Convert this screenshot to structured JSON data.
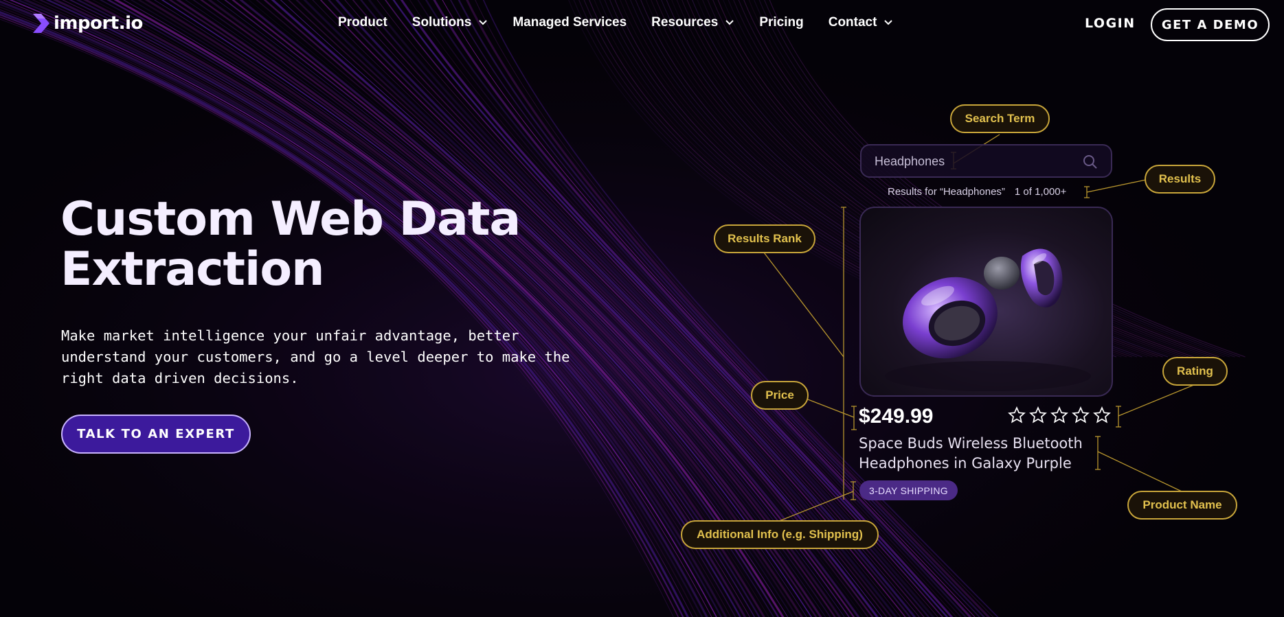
{
  "header": {
    "logo_text": "import.io",
    "nav": [
      {
        "label": "Product",
        "has_dropdown": false
      },
      {
        "label": "Solutions",
        "has_dropdown": true
      },
      {
        "label": "Managed Services",
        "has_dropdown": false
      },
      {
        "label": "Resources",
        "has_dropdown": true
      },
      {
        "label": "Pricing",
        "has_dropdown": false
      },
      {
        "label": "Contact",
        "has_dropdown": true
      }
    ],
    "login_label": "LOGIN",
    "demo_label": "GET A DEMO"
  },
  "hero": {
    "title_line1": "Custom Web Data",
    "title_line2": "Extraction",
    "subtitle_line1": "Make market intelligence your unfair advantage, better",
    "subtitle_line2": "understand your customers, and go a level deeper to make the",
    "subtitle_line3": "right data driven decisions.",
    "cta_label": "TALK TO AN EXPERT"
  },
  "diagram": {
    "tags": {
      "search_term": "Search Term",
      "results": "Results",
      "results_rank": "Results Rank",
      "rating": "Rating",
      "price": "Price",
      "product_name": "Product Name",
      "additional_info": "Additional Info (e.g. Shipping)"
    },
    "search_value": "Headphones",
    "results_text": "Results for “Headphones”",
    "results_count": "1 of 1,000+",
    "price": "$249.99",
    "rating_stars": 5,
    "rating_filled": 0,
    "product_name_line1": "Space Buds Wireless Bluetooth",
    "product_name_line2": "Headphones in Galaxy Purple",
    "shipping_badge": "3-DAY SHIPPING"
  },
  "colors": {
    "background": "#050208",
    "accent_purple": "#3c1a9c",
    "tag_gold": "#e2c14e",
    "badge_purple": "#4b2a86"
  },
  "icons": [
    "logo-mark-icon",
    "chevron-down-icon",
    "search-icon",
    "star-outline-icon"
  ]
}
